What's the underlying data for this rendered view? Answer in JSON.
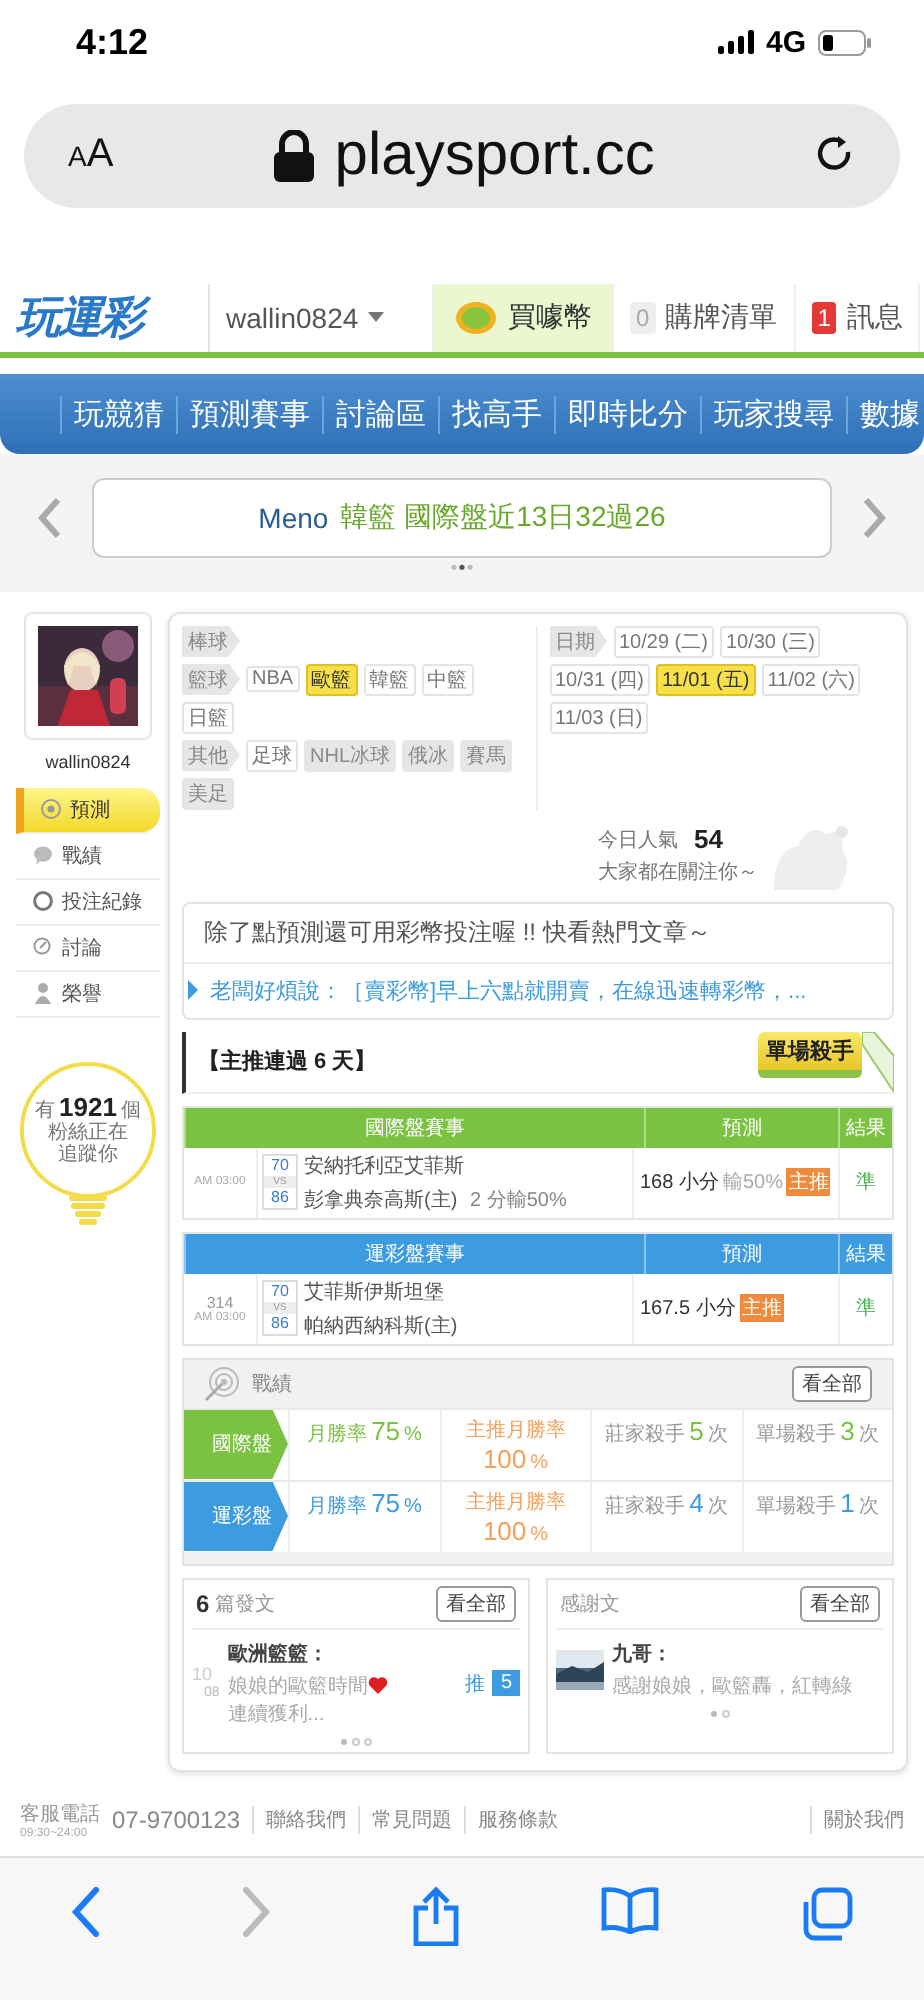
{
  "status_bar": {
    "time": "4:12",
    "network": "4G"
  },
  "browser": {
    "text_size": "AA",
    "url": "playsport.cc"
  },
  "header": {
    "logo": "玩運彩",
    "username": "wallin0824",
    "coin_label": "買噱幣",
    "cart": {
      "count": "0",
      "label": "購牌清單"
    },
    "messages": {
      "count": "1",
      "label": "訊息"
    }
  },
  "nav": [
    "玩競猜",
    "預測賽事",
    "討論區",
    "找高手",
    "即時比分",
    "玩家搜尋",
    "數據"
  ],
  "banner": {
    "name": "Meno",
    "text": "韓籃 國際盤近13日32過26"
  },
  "sidebar": {
    "username": "wallin0824",
    "menu": [
      {
        "kind": "predict",
        "label": "預測",
        "selected": true
      },
      {
        "kind": "record",
        "label": "戰績",
        "selected": false
      },
      {
        "kind": "history",
        "label": "投注紀錄",
        "selected": false
      },
      {
        "kind": "discuss",
        "label": "討論",
        "selected": false
      },
      {
        "kind": "honor",
        "label": "榮譽",
        "selected": false
      }
    ],
    "fans": {
      "prefix": "有",
      "count": "1921",
      "suffix": "個",
      "note": "粉絲正在追蹤你"
    }
  },
  "sports": [
    {
      "group": "棒球"
    },
    {
      "group": "籃球",
      "items": [
        {
          "label": "NBA",
          "selected": false,
          "disabled": false
        },
        {
          "label": "歐籃",
          "selected": true,
          "disabled": false
        },
        {
          "label": "韓籃",
          "selected": false,
          "disabled": false
        },
        {
          "label": "中籃",
          "selected": false,
          "disabled": false
        },
        {
          "label": "日籃",
          "selected": false,
          "disabled": false
        }
      ]
    },
    {
      "group": "其他",
      "items": [
        {
          "label": "足球",
          "selected": false,
          "disabled": false
        },
        {
          "label": "NHL冰球",
          "selected": false,
          "disabled": true
        },
        {
          "label": "俄冰",
          "selected": false,
          "disabled": true
        },
        {
          "label": "賽馬",
          "selected": false,
          "disabled": true
        },
        {
          "label": "美足",
          "selected": false,
          "disabled": true
        }
      ]
    }
  ],
  "dates": {
    "label": "日期",
    "items": [
      {
        "label": "10/29 (二)",
        "selected": false
      },
      {
        "label": "10/30 (三)",
        "selected": false
      },
      {
        "label": "10/31 (四)",
        "selected": false
      },
      {
        "label": "11/01 (五)",
        "selected": true
      },
      {
        "label": "11/02 (六)",
        "selected": false
      },
      {
        "label": "11/03 (日)",
        "selected": false
      }
    ]
  },
  "popularity": {
    "label": "今日人氣",
    "value": "54",
    "note": "大家都在關注你～"
  },
  "notice": {
    "headline": "除了點預測還可用彩幣投注喔 !! 快看熱門文章～",
    "link": "老闆好煩說：［賣彩幣]早上六點就開賣，在線迅速轉彩幣，..."
  },
  "streak": {
    "title": "【主推連過 6 天】",
    "badge": "單場殺手"
  },
  "tables": [
    {
      "color": "#7cc242",
      "header": "國際盤賽事",
      "pred_header": "預測",
      "result_header": "結果",
      "rows": [
        {
          "time": "AM 03:00",
          "score_away": "70",
          "vs": "VS",
          "score_home": "86",
          "away": "安納托利亞艾菲斯",
          "home": "彭拿典奈高斯(主)",
          "spread": "2 分輸50%",
          "prediction": "168 小分",
          "pred_note": "輸50%",
          "tag": "主推",
          "result": "準"
        }
      ]
    },
    {
      "color": "#3d9be0",
      "header": "運彩盤賽事",
      "pred_header": "預測",
      "result_header": "結果",
      "rows": [
        {
          "code": "314",
          "time": "AM 03:00",
          "score_away": "70",
          "vs": "VS",
          "score_home": "86",
          "away": "艾菲斯伊斯坦堡",
          "home": "帕納西納科斯(主)",
          "prediction": "167.5 小分",
          "tag": "主推",
          "result": "準"
        }
      ]
    }
  ],
  "record": {
    "title": "戰績",
    "more": "看全部",
    "rows": [
      {
        "label": "國際盤",
        "color": "#7cc242",
        "cells": [
          {
            "label": "月勝率",
            "value": "75",
            "unit": "%"
          },
          {
            "label": "主推月勝率",
            "value": "100",
            "unit": "%"
          },
          {
            "label": "莊家殺手",
            "value": "5",
            "unit": "次"
          },
          {
            "label": "單場殺手",
            "value": "3",
            "unit": "次"
          }
        ]
      },
      {
        "label": "運彩盤",
        "color": "#3d9be0",
        "cells": [
          {
            "label": "月勝率",
            "value": "75",
            "unit": "%"
          },
          {
            "label": "主推月勝率",
            "value": "100",
            "unit": "%"
          },
          {
            "label": "莊家殺手",
            "value": "4",
            "unit": "次"
          },
          {
            "label": "單場殺手",
            "value": "1",
            "unit": "次"
          }
        ]
      }
    ]
  },
  "posts": {
    "count": "6",
    "title": "篇發文",
    "more": "看全部",
    "day": "10",
    "month": "08",
    "author": "歐洲籃籃：",
    "text": "娘娘的歐籃時間",
    "text_after": "連續獲利...",
    "push_label": "推",
    "push_count": "5"
  },
  "thanks": {
    "title": "感謝文",
    "more": "看全部",
    "author": "九哥：",
    "text": "感謝娘娘，歐籃轟，紅轉綠"
  },
  "footer": {
    "label": "客服電話",
    "hours": "09:30~24:00",
    "phone": "07-9700123",
    "links": [
      "聯絡我們",
      "常見問題",
      "服務條款"
    ],
    "about": "關於我們"
  },
  "toolbar": [
    {
      "kind": "back",
      "disabled": false
    },
    {
      "kind": "forward",
      "disabled": true
    },
    {
      "kind": "share",
      "disabled": false
    },
    {
      "kind": "bookmarks",
      "disabled": false
    },
    {
      "kind": "tabs",
      "disabled": false
    }
  ]
}
